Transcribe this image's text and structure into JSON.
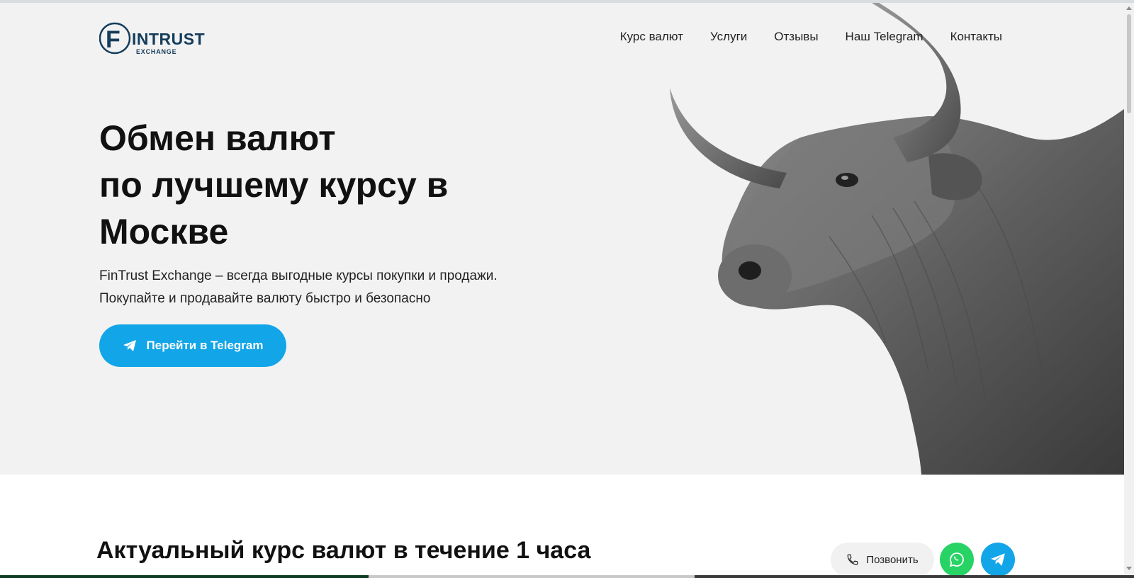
{
  "brand": {
    "logo_initial": "F",
    "logo_main": "INTRUST",
    "logo_sub": "EXCHANGE",
    "color": "#153d5c"
  },
  "nav": {
    "items": [
      {
        "label": "Курс валют"
      },
      {
        "label": "Услуги"
      },
      {
        "label": "Отзывы"
      },
      {
        "label": "Наш Telegram"
      },
      {
        "label": "Контакты"
      }
    ]
  },
  "hero": {
    "title_lines": [
      "Обмен валют",
      "по лучшему курсу в",
      "Москве"
    ],
    "description_lines": [
      "FinTrust Exchange – всегда выгодные курсы покупки и продажи.",
      "Покупайте и продавайте валюту быстро и безопасно"
    ],
    "cta_label": "Перейти в Telegram",
    "cta_icon": "telegram-plane-icon",
    "image": "bull-photo"
  },
  "rates_section": {
    "title": "Актуальный курс валют в течение 1 часа"
  },
  "floating": {
    "call_label": "Позвонить",
    "call_icon": "phone-icon",
    "whatsapp_icon": "whatsapp-icon",
    "telegram_icon": "telegram-icon"
  },
  "colors": {
    "hero_bg": "#f2f2f2",
    "accent": "#12a5e8",
    "whatsapp": "#27d365"
  }
}
